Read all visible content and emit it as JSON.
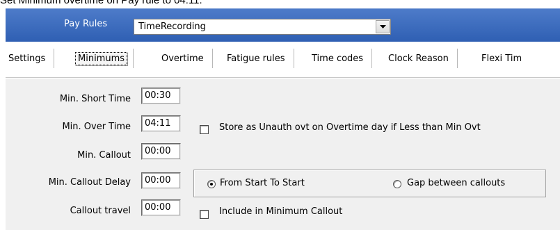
{
  "instruction": "Set Minimum overtime on Pay rule to 04:11.",
  "header": {
    "label": "Pay Rules",
    "combo_value": "TimeRecording"
  },
  "tabs": [
    {
      "label": "Settings"
    },
    {
      "label": "Minimums"
    },
    {
      "label": "Overtime"
    },
    {
      "label": "Fatigue rules"
    },
    {
      "label": "Time codes"
    },
    {
      "label": "Clock Reason"
    },
    {
      "label": "Flexi Tim"
    }
  ],
  "fields": {
    "min_short_time": {
      "label": "Min. Short Time",
      "value": "00:30"
    },
    "min_over_time": {
      "label": "Min. Over Time",
      "value": "04:11"
    },
    "min_callout": {
      "label": "Min. Callout",
      "value": "00:00"
    },
    "min_callout_delay": {
      "label": "Min. Callout Delay",
      "value": "00:00"
    },
    "callout_travel": {
      "label": "Callout travel",
      "value": "00:00"
    }
  },
  "checkboxes": {
    "store_unauth": {
      "label": "Store as Unauth ovt on Overtime day if Less than Min Ovt",
      "checked": false
    },
    "include_min_callout": {
      "label": "Include in Minimum Callout",
      "checked": false
    }
  },
  "radios": {
    "from_start": {
      "label": "From Start To Start",
      "selected": true
    },
    "gap_between": {
      "label": "Gap between callouts",
      "selected": false
    }
  }
}
